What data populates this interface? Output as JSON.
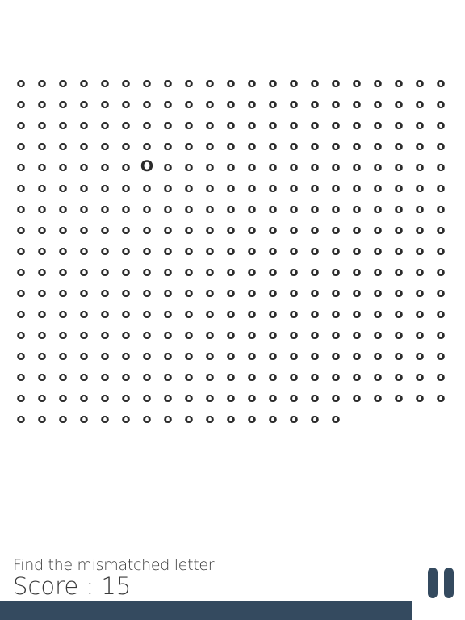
{
  "game": {
    "base_letter": "o",
    "odd_letter": "O",
    "rows": 17,
    "cols": 21,
    "last_row_count": 16,
    "odd_position": {
      "row": 4,
      "col": 6
    },
    "letter_color": "#2b2b2b"
  },
  "footer": {
    "instruction": "Find the mismatched letter",
    "score_text": "Score : 15",
    "pause_icon": "pause-icon",
    "accent_color": "#344a5f"
  },
  "timer": {
    "remaining_fraction": 0.885
  }
}
